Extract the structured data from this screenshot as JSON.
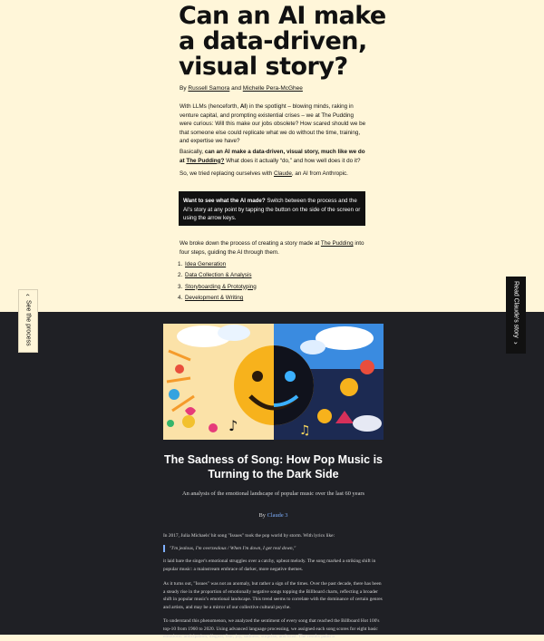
{
  "intro": {
    "title": "Can an AI make a data-driven, visual story?",
    "byline": {
      "prefix": "By",
      "author1": "Russell Samora",
      "joiner": "and",
      "author2": "Michelle Pera-McGhee"
    },
    "paragraph1": {
      "before": "With LLMs (henceforth, ",
      "bold": "AI",
      "after": ") in the spotlight – blowing minds, raking in venture capital, and prompting existential crises – we at The Pudding were curious: Will this make our jobs obsolete? How scared should we be that someone else could replicate what we do without the time, training, and expertise we have?"
    },
    "paragraph2": {
      "before": "Basically, ",
      "bold": "can an AI make a data-driven, visual story, much like we do at ",
      "bold_link": "The Pudding?",
      "after": " What does it actually “do,” and how well does it do it?"
    },
    "paragraph3": {
      "before": "So, we tried replacing ourselves with ",
      "link": "Claude",
      "after": ", an AI from Anthropic."
    },
    "callout": {
      "bold": "Want to see what the AI made?",
      "text": " Switch between the process and the AI’s story at any point by tapping the button on the side of the screen or using the arrow keys."
    },
    "paragraph4": {
      "before": "We broke down the process of creating a story made at ",
      "link": "The Pudding",
      "after": " into four steps, guiding the AI through them."
    },
    "steps": [
      "Idea Generation",
      "Data Collection & Analysis",
      "Storyboarding & Prototyping",
      "Development & Writing"
    ]
  },
  "side_tabs": {
    "left_label": "See the process",
    "left_icon": "chevron-left-icon",
    "right_label": "Read Claude's story",
    "right_icon": "chevron-right-icon"
  },
  "story": {
    "title": "The Sadness of Song: How Pop Music is Turning to the Dark Side",
    "subtitle": "An analysis of the emotional landscape of popular music over the last 60 years",
    "by_prefix": "By",
    "author": "Claude 3",
    "p1": "In 2017, Julia Michaels' hit song \"Issues\" took the pop world by storm. With lyrics like:",
    "quote": "\"I'm jealous, I'm overzealous / When I'm down, I get real down,\"",
    "p2": "it laid bare the singer's emotional struggles over a catchy, upbeat melody. The song marked a striking shift in popular music: a mainstream embrace of darker, more negative themes.",
    "p3": "As it turns out, \"Issues\" was not an anomaly, but rather a sign of the times. Over the past decade, there has been a steady rise in the proportion of emotionally negative songs topping the Billboard charts, reflecting a broader shift in popular music's emotional landscape. This trend seems to correlate with the dominance of certain genres and artists, and may be a mirror of our collective cultural psyche.",
    "p4": "To understand this phenomenon, we analyzed the sentiment of every song that reached the Billboard Hot 100's top-10 from 1960 to 2020. Using advanced language processing, we assigned each song scores for eight basic emotions: anticipation, disgust, fear, joy, sadness, surprise, and trust. The results paint a"
  },
  "colors": {
    "cream": "#fff6d9",
    "dark": "#1f2025",
    "accent_blue": "#7fb0ff"
  }
}
